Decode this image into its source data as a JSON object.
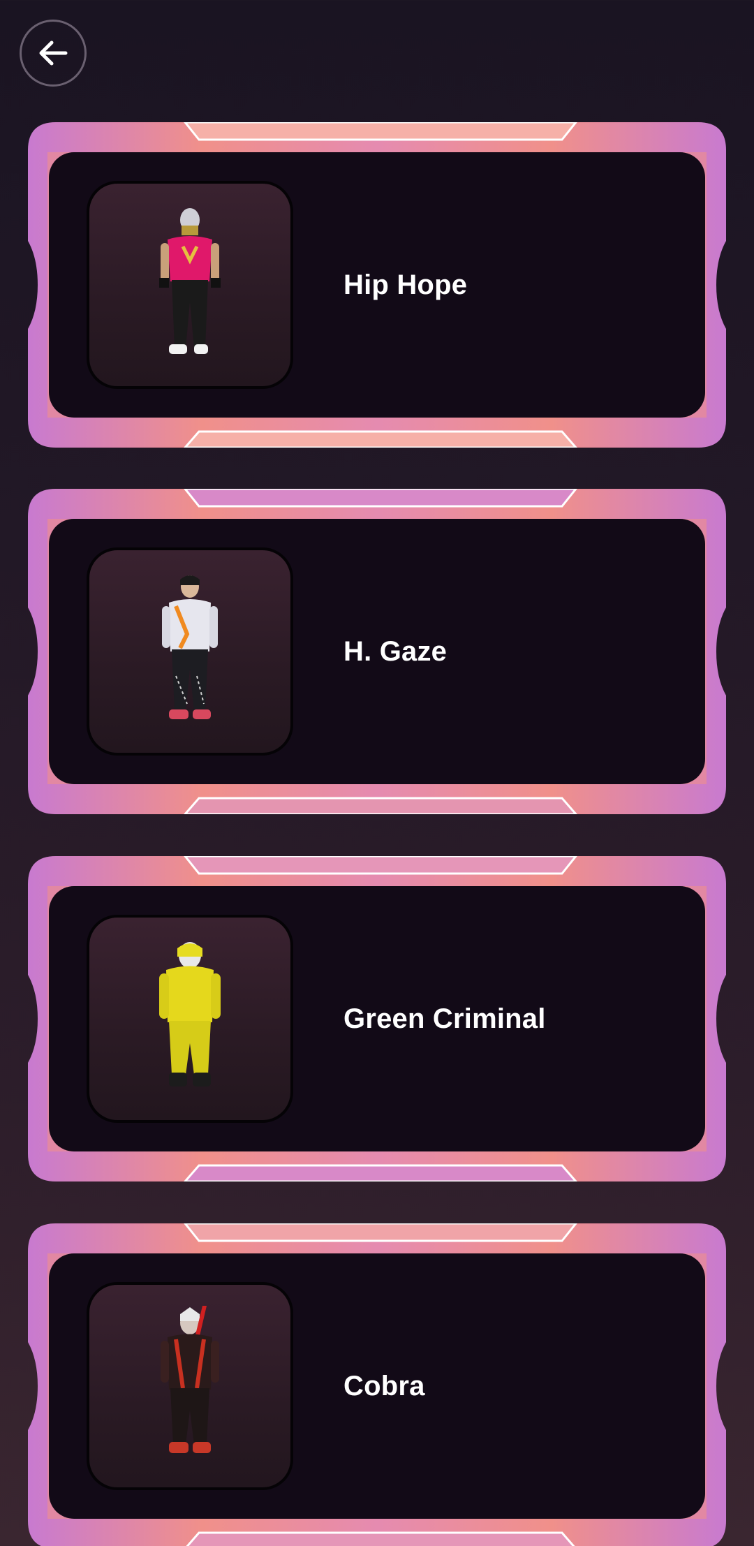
{
  "header": {
    "back_icon": "arrow-left-icon"
  },
  "colors": {
    "background_top": "#1a1422",
    "background_bottom": "#3a2630",
    "frame_pink": "#f0908a",
    "frame_purple": "#c87ad0",
    "card_inner": "#120a17"
  },
  "characters": [
    {
      "name": "Hip Hope"
    },
    {
      "name": "H. Gaze"
    },
    {
      "name": "Green Criminal"
    },
    {
      "name": "Cobra"
    }
  ]
}
